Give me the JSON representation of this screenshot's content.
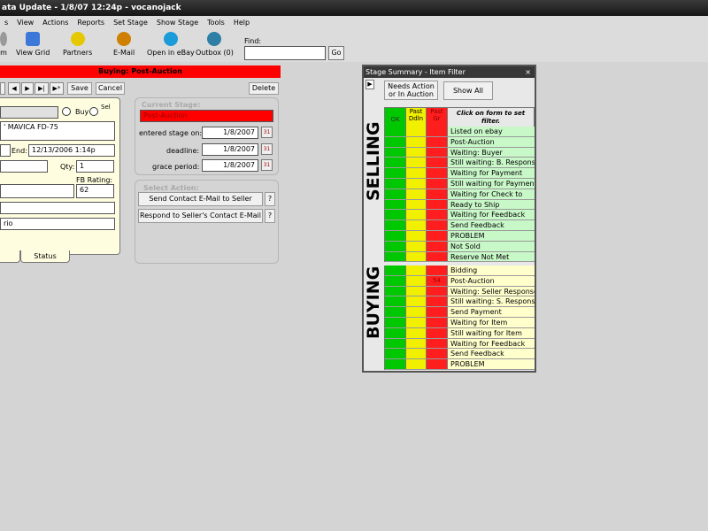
{
  "window": {
    "title": "ata Update - 1/8/07 12:24p - vocanojack"
  },
  "menu": [
    "s",
    "View",
    "Actions",
    "Reports",
    "Set Stage",
    "Show Stage",
    "Tools",
    "Help"
  ],
  "toolbar": {
    "buttons": [
      {
        "label": "m",
        "icon": "partial-icon",
        "color": "#999999"
      },
      {
        "label": "View Grid",
        "icon": "grid-icon",
        "color": "#3c78d8"
      },
      {
        "label": "Partners",
        "icon": "smiley-icon",
        "color": "#e6c800"
      },
      {
        "label": "E-Mail",
        "icon": "mail-icon",
        "color": "#d08000"
      },
      {
        "label": "Open in eBay",
        "icon": "money-icon",
        "color": "#1b9bd8"
      },
      {
        "label": "Outbox (0)",
        "icon": "outbox-icon",
        "color": "#2d7fa6"
      }
    ],
    "find_label": "Find:",
    "find_value": "",
    "go_label": "Go"
  },
  "record": {
    "banner": "Buying: Post-Auction",
    "nav": [
      "",
      "◀",
      "▶",
      "▶|",
      "▶*"
    ],
    "save_label": "Save",
    "cancel_label": "Cancel",
    "delete_label": "Delete"
  },
  "form": {
    "buy_label": "Buy",
    "sell_label": "Sel",
    "item_title": "' MAVICA FD-75",
    "end_label": "End:",
    "end_value": "12/13/2006 1:14p",
    "qty_label": "Qty:",
    "qty_value": "1",
    "fb_label": "FB Rating:",
    "fb_value": "62",
    "partial_value": "rio",
    "status_tab": "Status"
  },
  "stage": {
    "title": "Current Stage:",
    "value": "Post-Auction",
    "entered_label": "entered stage on:",
    "entered_value": "1/8/2007",
    "deadline_label": "deadline:",
    "deadline_value": "1/8/2007",
    "grace_label": "grace period:",
    "grace_value": "1/8/2007",
    "cal_icon": "31"
  },
  "action": {
    "title": "Select Action:",
    "btn1": "Send Contact E-Mail to Seller",
    "btn2": "Respond to Seller's Contact E-Mail",
    "help": "?"
  },
  "summary": {
    "title": "Stage Summary - Item Filter",
    "close": "×",
    "needs_btn": "Needs Action or In Auction",
    "show_all": "Show All",
    "hdr_ok": "OK",
    "hdr_past": "Past Ddln",
    "hdr_late": "Past Gr",
    "hint": "Click on form to set filter.",
    "selling_label": "SELLING",
    "buying_label": "BUYING",
    "selling": [
      {
        "label": "Listed on ebay",
        "late": ""
      },
      {
        "label": "Post-Auction",
        "late": ""
      },
      {
        "label": "Waiting: Buyer",
        "late": ""
      },
      {
        "label": "Still waiting: B. Response",
        "late": ""
      },
      {
        "label": "Waiting for Payment",
        "late": ""
      },
      {
        "label": "Still waiting for Payment",
        "late": ""
      },
      {
        "label": "Waiting for Check to",
        "late": ""
      },
      {
        "label": "Ready to Ship",
        "late": ""
      },
      {
        "label": "Waiting for Feedback",
        "late": ""
      },
      {
        "label": "Send Feedback",
        "late": ""
      },
      {
        "label": "PROBLEM",
        "late": ""
      },
      {
        "label": "Not Sold",
        "late": ""
      },
      {
        "label": "Reserve Not Met",
        "late": ""
      }
    ],
    "buying": [
      {
        "label": "Bidding",
        "late": ""
      },
      {
        "label": "Post-Auction",
        "late": "54"
      },
      {
        "label": "Waiting: Seller Response",
        "late": ""
      },
      {
        "label": "Still waiting: S. Response",
        "late": ""
      },
      {
        "label": "Send Payment",
        "late": ""
      },
      {
        "label": "Waiting for Item",
        "late": ""
      },
      {
        "label": "Still waiting for Item",
        "late": ""
      },
      {
        "label": "Waiting for Feedback",
        "late": ""
      },
      {
        "label": "Send Feedback",
        "late": ""
      },
      {
        "label": "PROBLEM",
        "late": ""
      }
    ]
  }
}
